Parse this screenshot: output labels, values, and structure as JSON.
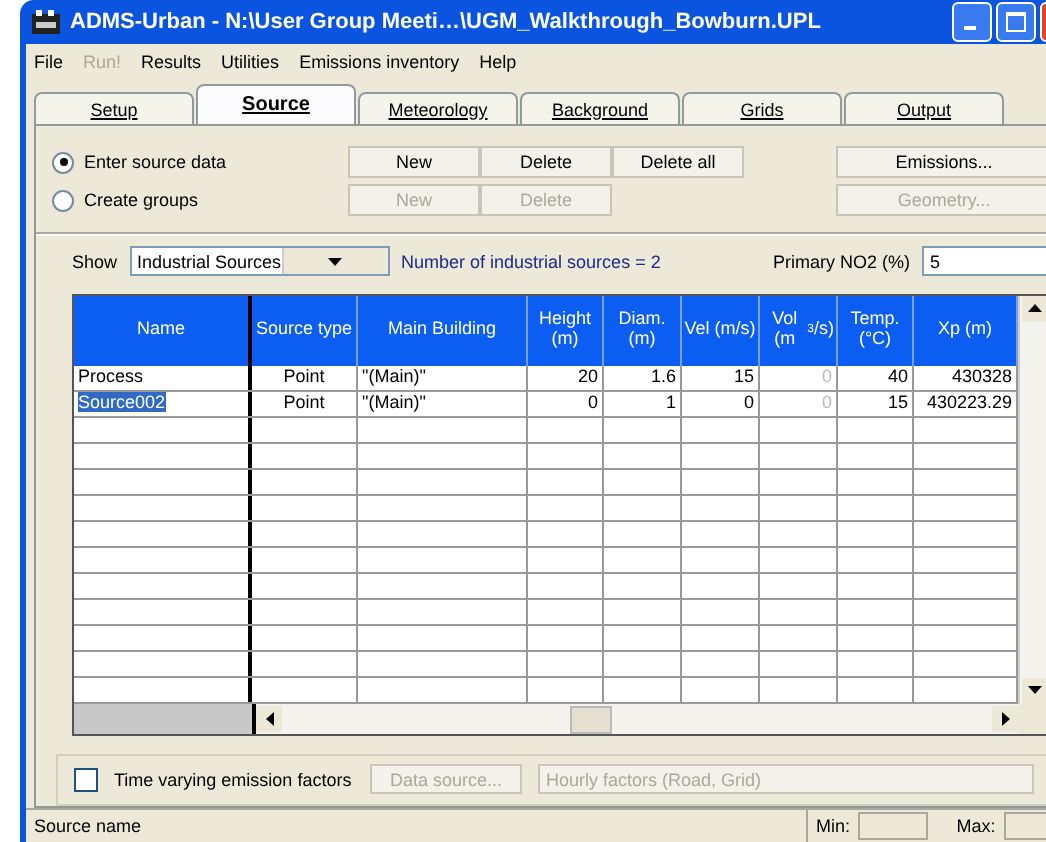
{
  "window": {
    "title": "ADMS-Urban - N:\\User Group Meeti…\\UGM_Walkthrough_Bowburn.UPL"
  },
  "menu": [
    {
      "label": "File",
      "disabled": false
    },
    {
      "label": "Run!",
      "disabled": true
    },
    {
      "label": "Results",
      "disabled": false
    },
    {
      "label": "Utilities",
      "disabled": false
    },
    {
      "label": "Emissions inventory",
      "disabled": false
    },
    {
      "label": "Help",
      "disabled": false
    }
  ],
  "tabs": [
    {
      "label": "Setup",
      "selected": false
    },
    {
      "label": "Source",
      "selected": true
    },
    {
      "label": "Meteorology",
      "selected": false
    },
    {
      "label": "Background",
      "selected": false
    },
    {
      "label": "Grids",
      "selected": false
    },
    {
      "label": "Output",
      "selected": false
    }
  ],
  "modes": [
    {
      "label": "Enter source data",
      "selected": true,
      "buttons": [
        {
          "label": "New",
          "disabled": false
        },
        {
          "label": "Delete",
          "disabled": false
        },
        {
          "label": "Delete all",
          "disabled": false
        }
      ],
      "side_button": {
        "label": "Emissions...",
        "disabled": false
      }
    },
    {
      "label": "Create groups",
      "selected": false,
      "buttons": [
        {
          "label": "New",
          "disabled": true
        },
        {
          "label": "Delete",
          "disabled": true
        }
      ],
      "side_button": {
        "label": "Geometry...",
        "disabled": true
      }
    }
  ],
  "show": {
    "label": "Show",
    "value": "Industrial Sources",
    "count_text": "Number of industrial sources = 2",
    "no2_label": "Primary NO2 (%)",
    "no2_value": "5"
  },
  "table": {
    "columns": [
      {
        "label": "Name",
        "greyed": false
      },
      {
        "label": "Source type",
        "greyed": false
      },
      {
        "label": "Main Building",
        "greyed": false
      },
      {
        "label": "Height (m)",
        "greyed": false
      },
      {
        "label": "Diam. (m)",
        "greyed": false
      },
      {
        "label": "Vel (m/s)",
        "greyed": false
      },
      {
        "label": "Vol (m$^{3}$/s)",
        "greyed": true
      },
      {
        "label": "Temp. (°C)",
        "greyed": false
      },
      {
        "label": "Xp (m)",
        "greyed": false
      }
    ],
    "rows": [
      {
        "selected": false,
        "cells": [
          "Process",
          "Point",
          "\"(Main)\"",
          "20",
          "1.6",
          "15",
          "0",
          "40",
          "430328"
        ]
      },
      {
        "selected": true,
        "cells": [
          "Source002",
          "Point",
          "\"(Main)\"",
          "0",
          "1",
          "0",
          "0",
          "15",
          "430223.29"
        ]
      }
    ]
  },
  "time_varying": {
    "label": "Time varying emission factors",
    "checked": false,
    "data_source": {
      "label": "Data source...",
      "disabled": true
    },
    "factors": {
      "value": "Hourly factors (Road, Grid)",
      "disabled": true
    }
  },
  "status_bar": {
    "text": "Source name",
    "min_label": "Min:",
    "max_label": "Max:"
  }
}
